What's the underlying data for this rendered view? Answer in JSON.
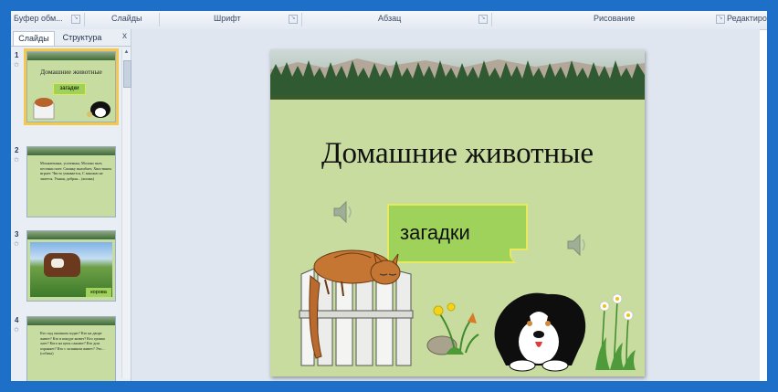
{
  "ribbon": {
    "groups": [
      "Буфер обм...",
      "Слайды",
      "Шрифт",
      "Абзац",
      "Рисование",
      "Редактирование"
    ]
  },
  "pane": {
    "tabs": [
      "Слайды",
      "Структура"
    ],
    "close": "x",
    "slides": [
      {
        "number": "1",
        "title": "Домашние животные",
        "box": "загадки",
        "selected": true
      },
      {
        "number": "2",
        "text": "Мохнатенька, усатенька, Молоко пьет, песенки поет. Спинку выгибает, Хвостиком играет. Чисто умывается, С мышью не знается. Умная, добрая... (кошка)"
      },
      {
        "number": "3",
        "label": "корова"
      },
      {
        "number": "4",
        "text": "Кто под окошком ходит? Кто на дворе живет? Кто в конуре живет? Кто громко лает? Кого на цепь сажают? Кто дом охраняет? Кто с хозяином живет? Это... (собака)"
      }
    ]
  },
  "slide": {
    "title": "Домашние животные",
    "box_text": "загадки",
    "icons": [
      "speaker-icon",
      "speaker-icon",
      "cat-on-fence-illustration",
      "flowers-illustration",
      "dog-illustration",
      "daisies-illustration"
    ]
  },
  "colors": {
    "frame": "#1e6fc8",
    "slide_bg": "#c7dc9e",
    "box_fill": "#9ed25a",
    "box_border": "#e6ea5c",
    "selected_outline": "#f4c84a"
  }
}
